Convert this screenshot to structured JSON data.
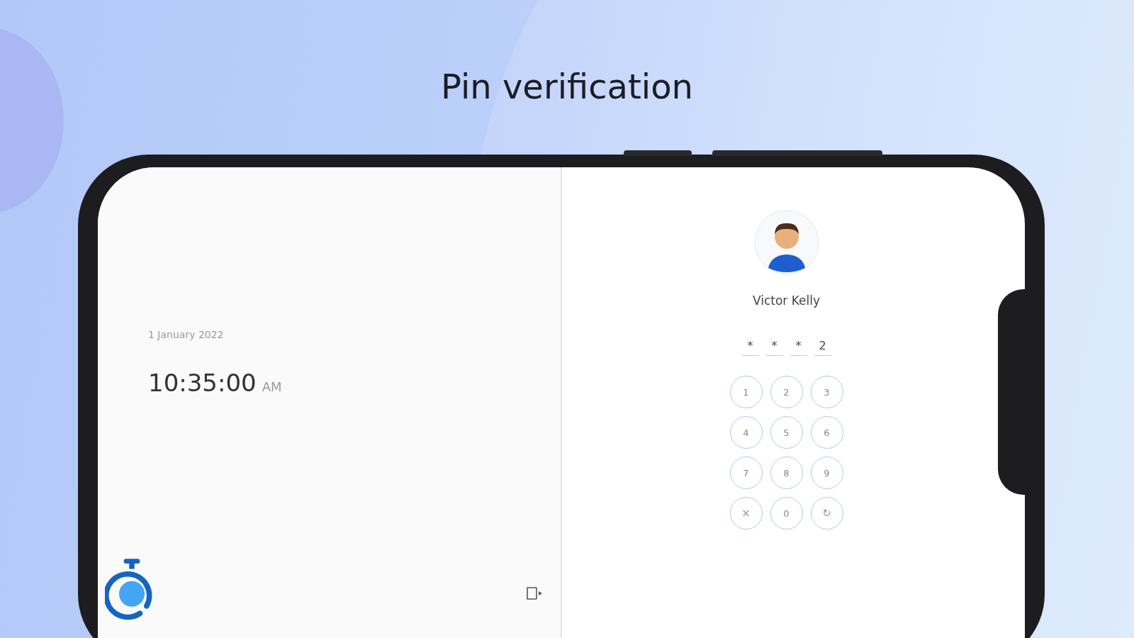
{
  "title": "Pin verification",
  "clock": {
    "date": "1 January 2022",
    "time": "10:35:00",
    "meridiem": "AM"
  },
  "user": {
    "name": "Victor Kelly"
  },
  "pin": [
    "*",
    "*",
    "*",
    "2"
  ],
  "keypad": [
    {
      "label": "1",
      "kind": "digit"
    },
    {
      "label": "2",
      "kind": "digit"
    },
    {
      "label": "3",
      "kind": "digit"
    },
    {
      "label": "4",
      "kind": "digit"
    },
    {
      "label": "5",
      "kind": "digit"
    },
    {
      "label": "6",
      "kind": "digit"
    },
    {
      "label": "7",
      "kind": "digit"
    },
    {
      "label": "8",
      "kind": "digit"
    },
    {
      "label": "9",
      "kind": "digit"
    },
    {
      "label": "×",
      "kind": "clear"
    },
    {
      "label": "0",
      "kind": "digit"
    },
    {
      "label": "↻",
      "kind": "refresh"
    }
  ]
}
